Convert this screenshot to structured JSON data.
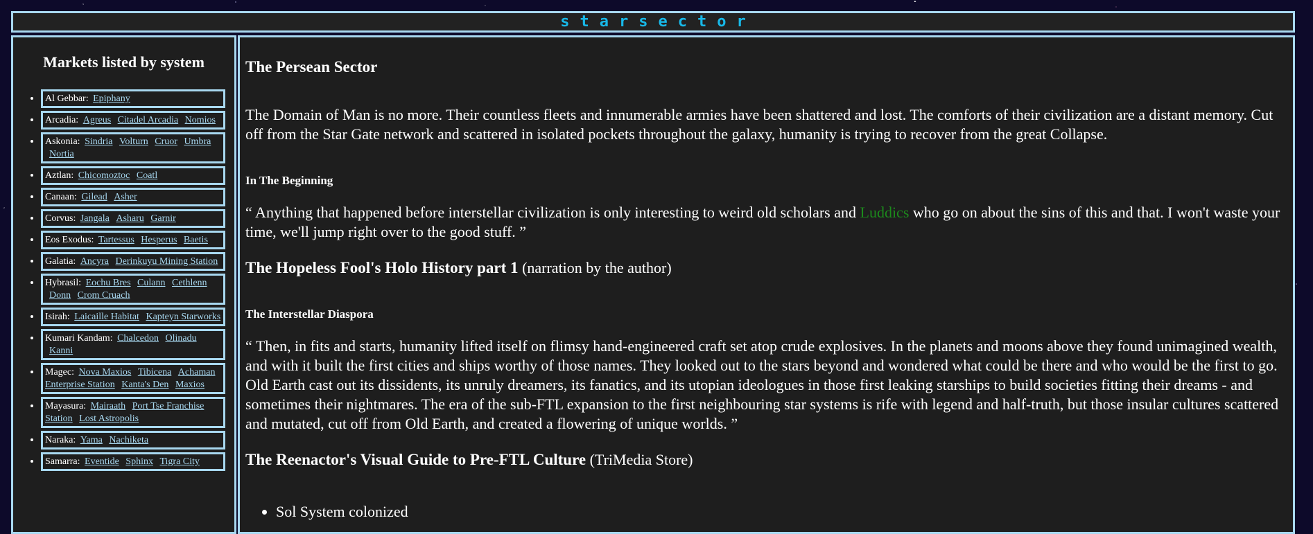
{
  "header": {
    "logo_text": "starsector"
  },
  "sidebar": {
    "title": "Markets listed by system",
    "systems": [
      {
        "name": "Al Gebbar:",
        "markets": [
          "Epiphany"
        ]
      },
      {
        "name": "Arcadia:",
        "markets": [
          "Agreus",
          "Citadel Arcadia",
          "Nomios"
        ]
      },
      {
        "name": "Askonia:",
        "markets": [
          "Sindria",
          "Volturn",
          "Cruor",
          "Umbra",
          "Nortia"
        ]
      },
      {
        "name": "Aztlan:",
        "markets": [
          "Chicomoztoc",
          "Coatl"
        ]
      },
      {
        "name": "Canaan:",
        "markets": [
          "Gilead",
          "Asher"
        ]
      },
      {
        "name": "Corvus:",
        "markets": [
          "Jangala",
          "Asharu",
          "Garnir"
        ]
      },
      {
        "name": "Eos Exodus:",
        "markets": [
          "Tartessus",
          "Hesperus",
          "Baetis"
        ]
      },
      {
        "name": "Galatia:",
        "markets": [
          "Ancyra",
          "Derinkuyu Mining Station"
        ]
      },
      {
        "name": "Hybrasil:",
        "markets": [
          "Eochu Bres",
          "Culann",
          "Cethlenn",
          "Donn",
          "Crom Cruach"
        ]
      },
      {
        "name": "Isirah:",
        "markets": [
          "Laicaille Habitat",
          "Kapteyn Starworks"
        ]
      },
      {
        "name": "Kumari Kandam:",
        "markets": [
          "Chalcedon",
          "Olinadu",
          "Kanni"
        ]
      },
      {
        "name": "Magec:",
        "markets": [
          "Nova Maxios",
          "Tibicena",
          "Achaman Enterprise Station",
          "Kanta's Den",
          "Maxios"
        ]
      },
      {
        "name": "Mayasura:",
        "markets": [
          "Mairaath",
          "Port Tse Franchise Station",
          "Lost Astropolis"
        ]
      },
      {
        "name": "Naraka:",
        "markets": [
          "Yama",
          "Nachiketa"
        ]
      },
      {
        "name": "Samarra:",
        "markets": [
          "Eventide",
          "Sphinx",
          "Tigra City"
        ]
      }
    ]
  },
  "main": {
    "heading": "The Persean Sector",
    "intro": "The Domain of Man is no more. Their countless fleets and innumerable armies have been shattered and lost. The comforts of their civilization are a distant memory. Cut off from the Star Gate network and scattered in isolated pockets throughout the galaxy, humanity is trying to recover from the great Collapse.",
    "section1": {
      "title": "In The Beginning",
      "quote_before": "“ Anything that happened before interstellar civilization is only interesting to weird old scholars and ",
      "quote_link": "Luddics",
      "quote_after": " who go on about the sins of this and that. I won't waste your time, we'll jump right over to the good stuff. ”",
      "source_title": "The Hopeless Fool's Holo History part 1",
      "source_note": " (narration by the author)"
    },
    "section2": {
      "title": "The Interstellar Diaspora",
      "quote": "“ Then, in fits and starts, humanity lifted itself on flimsy hand-engineered craft set atop crude explosives. In the planets and moons above they found unimagined wealth, and with it built the first cities and ships worthy of those names. They looked out to the stars beyond and wondered what could be there and who would be the first to go. Old Earth cast out its dissidents, its unruly dreamers, its fanatics, and its utopian ideologues in those first leaking starships to build societies fitting their dreams - and sometimes their nightmares. The era of the sub-FTL expansion to the first neighbouring star systems is rife with legend and half-truth, but those insular cultures scattered and mutated, cut off from Old Earth, and created a flowering of unique worlds. ”",
      "source_title": "The Reenactor's Visual Guide to Pre-FTL Culture",
      "source_note": " (TriMedia Store)"
    },
    "timeline": [
      "Sol System colonized"
    ]
  }
}
